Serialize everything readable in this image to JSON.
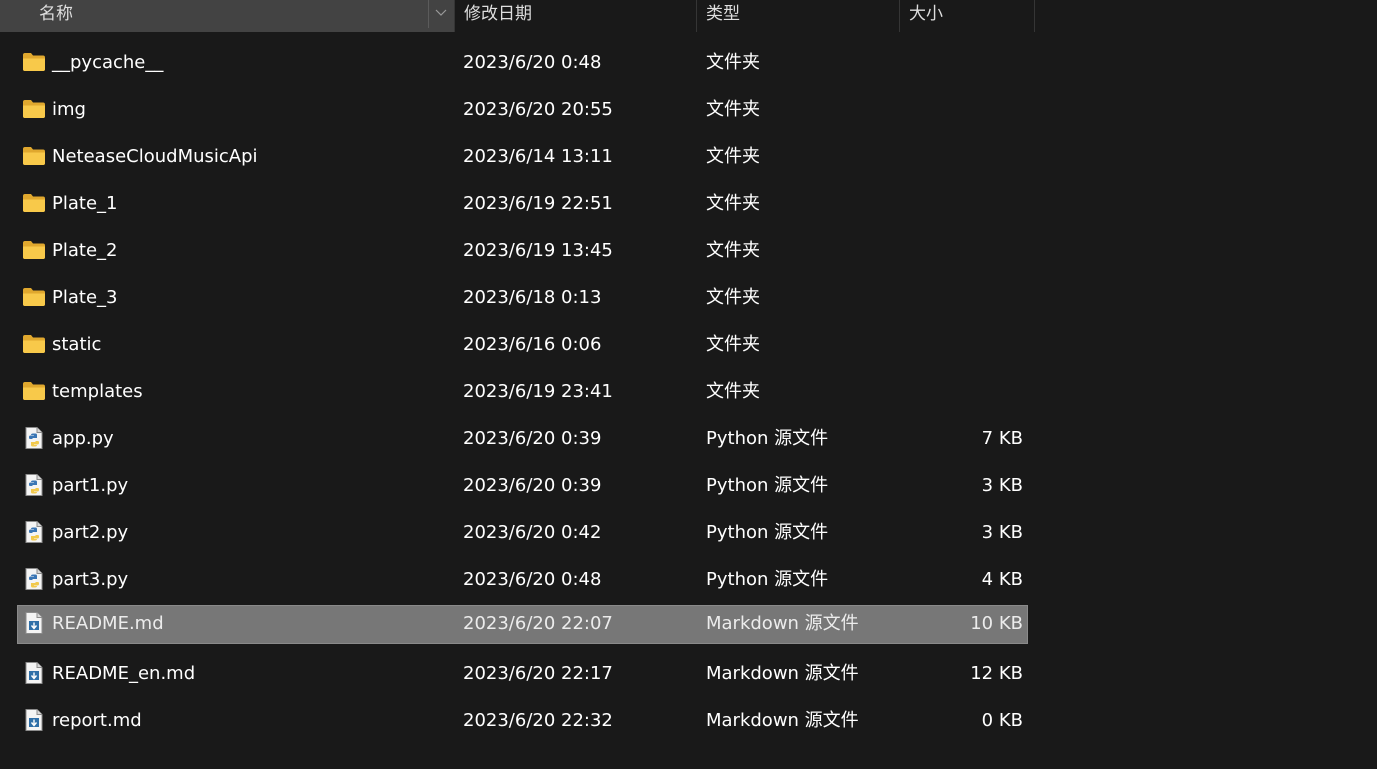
{
  "header": {
    "name": "名称",
    "date": "修改日期",
    "type": "类型",
    "size": "大小"
  },
  "colors": {
    "background": "#191919",
    "header_active": "#434343",
    "selected_row": "#777777",
    "folder": "#f7c948",
    "python_blue": "#3a76b5",
    "python_yellow": "#f2c94c"
  },
  "files": [
    {
      "name": "__pycache__",
      "date": "2023/6/20 0:48",
      "type": "文件夹",
      "size": "",
      "icon": "folder-icon"
    },
    {
      "name": "img",
      "date": "2023/6/20 20:55",
      "type": "文件夹",
      "size": "",
      "icon": "folder-icon"
    },
    {
      "name": "NeteaseCloudMusicApi",
      "date": "2023/6/14 13:11",
      "type": "文件夹",
      "size": "",
      "icon": "folder-icon"
    },
    {
      "name": "Plate_1",
      "date": "2023/6/19 22:51",
      "type": "文件夹",
      "size": "",
      "icon": "folder-icon"
    },
    {
      "name": "Plate_2",
      "date": "2023/6/19 13:45",
      "type": "文件夹",
      "size": "",
      "icon": "folder-icon"
    },
    {
      "name": "Plate_3",
      "date": "2023/6/18 0:13",
      "type": "文件夹",
      "size": "",
      "icon": "folder-icon"
    },
    {
      "name": "static",
      "date": "2023/6/16 0:06",
      "type": "文件夹",
      "size": "",
      "icon": "folder-icon"
    },
    {
      "name": "templates",
      "date": "2023/6/19 23:41",
      "type": "文件夹",
      "size": "",
      "icon": "folder-icon"
    },
    {
      "name": "app.py",
      "date": "2023/6/20 0:39",
      "type": "Python 源文件",
      "size": "7 KB",
      "icon": "python-file-icon"
    },
    {
      "name": "part1.py",
      "date": "2023/6/20 0:39",
      "type": "Python 源文件",
      "size": "3 KB",
      "icon": "python-file-icon"
    },
    {
      "name": "part2.py",
      "date": "2023/6/20 0:42",
      "type": "Python 源文件",
      "size": "3 KB",
      "icon": "python-file-icon"
    },
    {
      "name": "part3.py",
      "date": "2023/6/20 0:48",
      "type": "Python 源文件",
      "size": "4 KB",
      "icon": "python-file-icon"
    },
    {
      "name": "README.md",
      "date": "2023/6/20 22:07",
      "type": "Markdown 源文件",
      "size": "10 KB",
      "icon": "markdown-file-icon",
      "selected": true
    },
    {
      "name": "README_en.md",
      "date": "2023/6/20 22:17",
      "type": "Markdown 源文件",
      "size": "12 KB",
      "icon": "markdown-file-icon"
    },
    {
      "name": "report.md",
      "date": "2023/6/20 22:32",
      "type": "Markdown 源文件",
      "size": "0 KB",
      "icon": "markdown-file-icon"
    }
  ]
}
